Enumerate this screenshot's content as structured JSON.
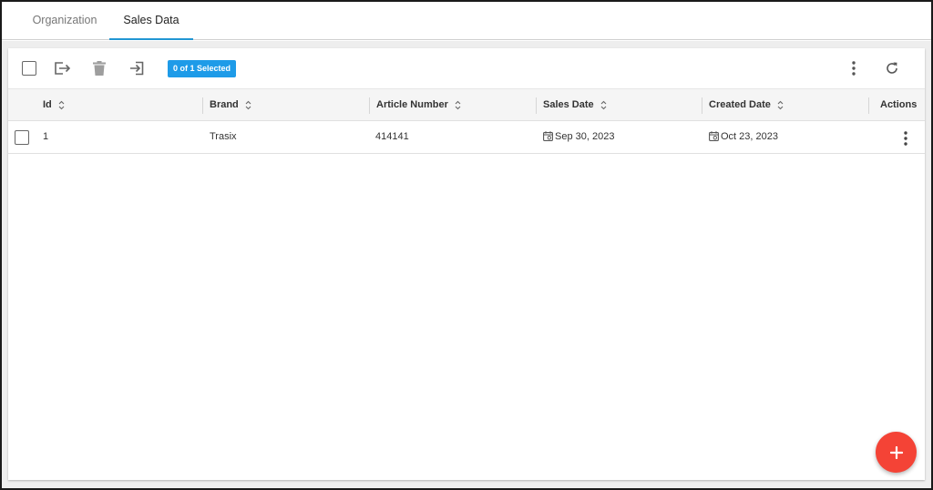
{
  "tabs": [
    {
      "label": "Organization",
      "active": false
    },
    {
      "label": "Sales Data",
      "active": true
    }
  ],
  "toolbar": {
    "selection_badge": "0 of 1 Selected",
    "icons": [
      "select-all-checkbox",
      "export-icon",
      "delete-icon",
      "import-icon",
      "more-vert-icon",
      "refresh-icon"
    ]
  },
  "table": {
    "columns": [
      "Id",
      "Brand",
      "Article Number",
      "Sales Date",
      "Created Date",
      "Actions"
    ],
    "rows": [
      {
        "id": "1",
        "brand": "Trasix",
        "article_number": "414141",
        "sales_date": "Sep 30, 2023",
        "created_date": "Oct 23, 2023"
      }
    ]
  },
  "colors": {
    "accent": "#2196d3",
    "badge": "#1e9be8",
    "fab": "#f44336"
  }
}
